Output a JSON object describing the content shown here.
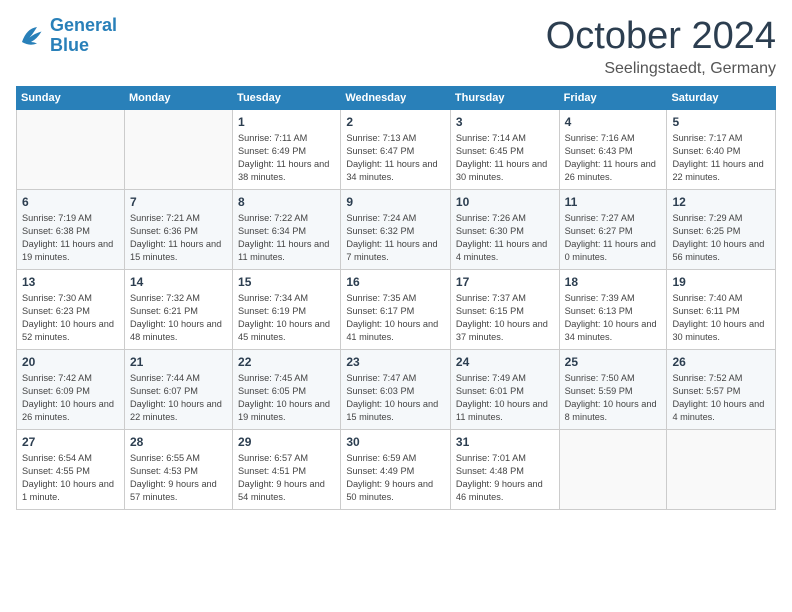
{
  "header": {
    "logo_line1": "General",
    "logo_line2": "Blue",
    "month": "October 2024",
    "location": "Seelingstaedt, Germany"
  },
  "weekdays": [
    "Sunday",
    "Monday",
    "Tuesday",
    "Wednesday",
    "Thursday",
    "Friday",
    "Saturday"
  ],
  "weeks": [
    [
      {
        "day": "",
        "info": ""
      },
      {
        "day": "",
        "info": ""
      },
      {
        "day": "1",
        "info": "Sunrise: 7:11 AM\nSunset: 6:49 PM\nDaylight: 11 hours and 38 minutes."
      },
      {
        "day": "2",
        "info": "Sunrise: 7:13 AM\nSunset: 6:47 PM\nDaylight: 11 hours and 34 minutes."
      },
      {
        "day": "3",
        "info": "Sunrise: 7:14 AM\nSunset: 6:45 PM\nDaylight: 11 hours and 30 minutes."
      },
      {
        "day": "4",
        "info": "Sunrise: 7:16 AM\nSunset: 6:43 PM\nDaylight: 11 hours and 26 minutes."
      },
      {
        "day": "5",
        "info": "Sunrise: 7:17 AM\nSunset: 6:40 PM\nDaylight: 11 hours and 22 minutes."
      }
    ],
    [
      {
        "day": "6",
        "info": "Sunrise: 7:19 AM\nSunset: 6:38 PM\nDaylight: 11 hours and 19 minutes."
      },
      {
        "day": "7",
        "info": "Sunrise: 7:21 AM\nSunset: 6:36 PM\nDaylight: 11 hours and 15 minutes."
      },
      {
        "day": "8",
        "info": "Sunrise: 7:22 AM\nSunset: 6:34 PM\nDaylight: 11 hours and 11 minutes."
      },
      {
        "day": "9",
        "info": "Sunrise: 7:24 AM\nSunset: 6:32 PM\nDaylight: 11 hours and 7 minutes."
      },
      {
        "day": "10",
        "info": "Sunrise: 7:26 AM\nSunset: 6:30 PM\nDaylight: 11 hours and 4 minutes."
      },
      {
        "day": "11",
        "info": "Sunrise: 7:27 AM\nSunset: 6:27 PM\nDaylight: 11 hours and 0 minutes."
      },
      {
        "day": "12",
        "info": "Sunrise: 7:29 AM\nSunset: 6:25 PM\nDaylight: 10 hours and 56 minutes."
      }
    ],
    [
      {
        "day": "13",
        "info": "Sunrise: 7:30 AM\nSunset: 6:23 PM\nDaylight: 10 hours and 52 minutes."
      },
      {
        "day": "14",
        "info": "Sunrise: 7:32 AM\nSunset: 6:21 PM\nDaylight: 10 hours and 48 minutes."
      },
      {
        "day": "15",
        "info": "Sunrise: 7:34 AM\nSunset: 6:19 PM\nDaylight: 10 hours and 45 minutes."
      },
      {
        "day": "16",
        "info": "Sunrise: 7:35 AM\nSunset: 6:17 PM\nDaylight: 10 hours and 41 minutes."
      },
      {
        "day": "17",
        "info": "Sunrise: 7:37 AM\nSunset: 6:15 PM\nDaylight: 10 hours and 37 minutes."
      },
      {
        "day": "18",
        "info": "Sunrise: 7:39 AM\nSunset: 6:13 PM\nDaylight: 10 hours and 34 minutes."
      },
      {
        "day": "19",
        "info": "Sunrise: 7:40 AM\nSunset: 6:11 PM\nDaylight: 10 hours and 30 minutes."
      }
    ],
    [
      {
        "day": "20",
        "info": "Sunrise: 7:42 AM\nSunset: 6:09 PM\nDaylight: 10 hours and 26 minutes."
      },
      {
        "day": "21",
        "info": "Sunrise: 7:44 AM\nSunset: 6:07 PM\nDaylight: 10 hours and 22 minutes."
      },
      {
        "day": "22",
        "info": "Sunrise: 7:45 AM\nSunset: 6:05 PM\nDaylight: 10 hours and 19 minutes."
      },
      {
        "day": "23",
        "info": "Sunrise: 7:47 AM\nSunset: 6:03 PM\nDaylight: 10 hours and 15 minutes."
      },
      {
        "day": "24",
        "info": "Sunrise: 7:49 AM\nSunset: 6:01 PM\nDaylight: 10 hours and 11 minutes."
      },
      {
        "day": "25",
        "info": "Sunrise: 7:50 AM\nSunset: 5:59 PM\nDaylight: 10 hours and 8 minutes."
      },
      {
        "day": "26",
        "info": "Sunrise: 7:52 AM\nSunset: 5:57 PM\nDaylight: 10 hours and 4 minutes."
      }
    ],
    [
      {
        "day": "27",
        "info": "Sunrise: 6:54 AM\nSunset: 4:55 PM\nDaylight: 10 hours and 1 minute."
      },
      {
        "day": "28",
        "info": "Sunrise: 6:55 AM\nSunset: 4:53 PM\nDaylight: 9 hours and 57 minutes."
      },
      {
        "day": "29",
        "info": "Sunrise: 6:57 AM\nSunset: 4:51 PM\nDaylight: 9 hours and 54 minutes."
      },
      {
        "day": "30",
        "info": "Sunrise: 6:59 AM\nSunset: 4:49 PM\nDaylight: 9 hours and 50 minutes."
      },
      {
        "day": "31",
        "info": "Sunrise: 7:01 AM\nSunset: 4:48 PM\nDaylight: 9 hours and 46 minutes."
      },
      {
        "day": "",
        "info": ""
      },
      {
        "day": "",
        "info": ""
      }
    ]
  ]
}
